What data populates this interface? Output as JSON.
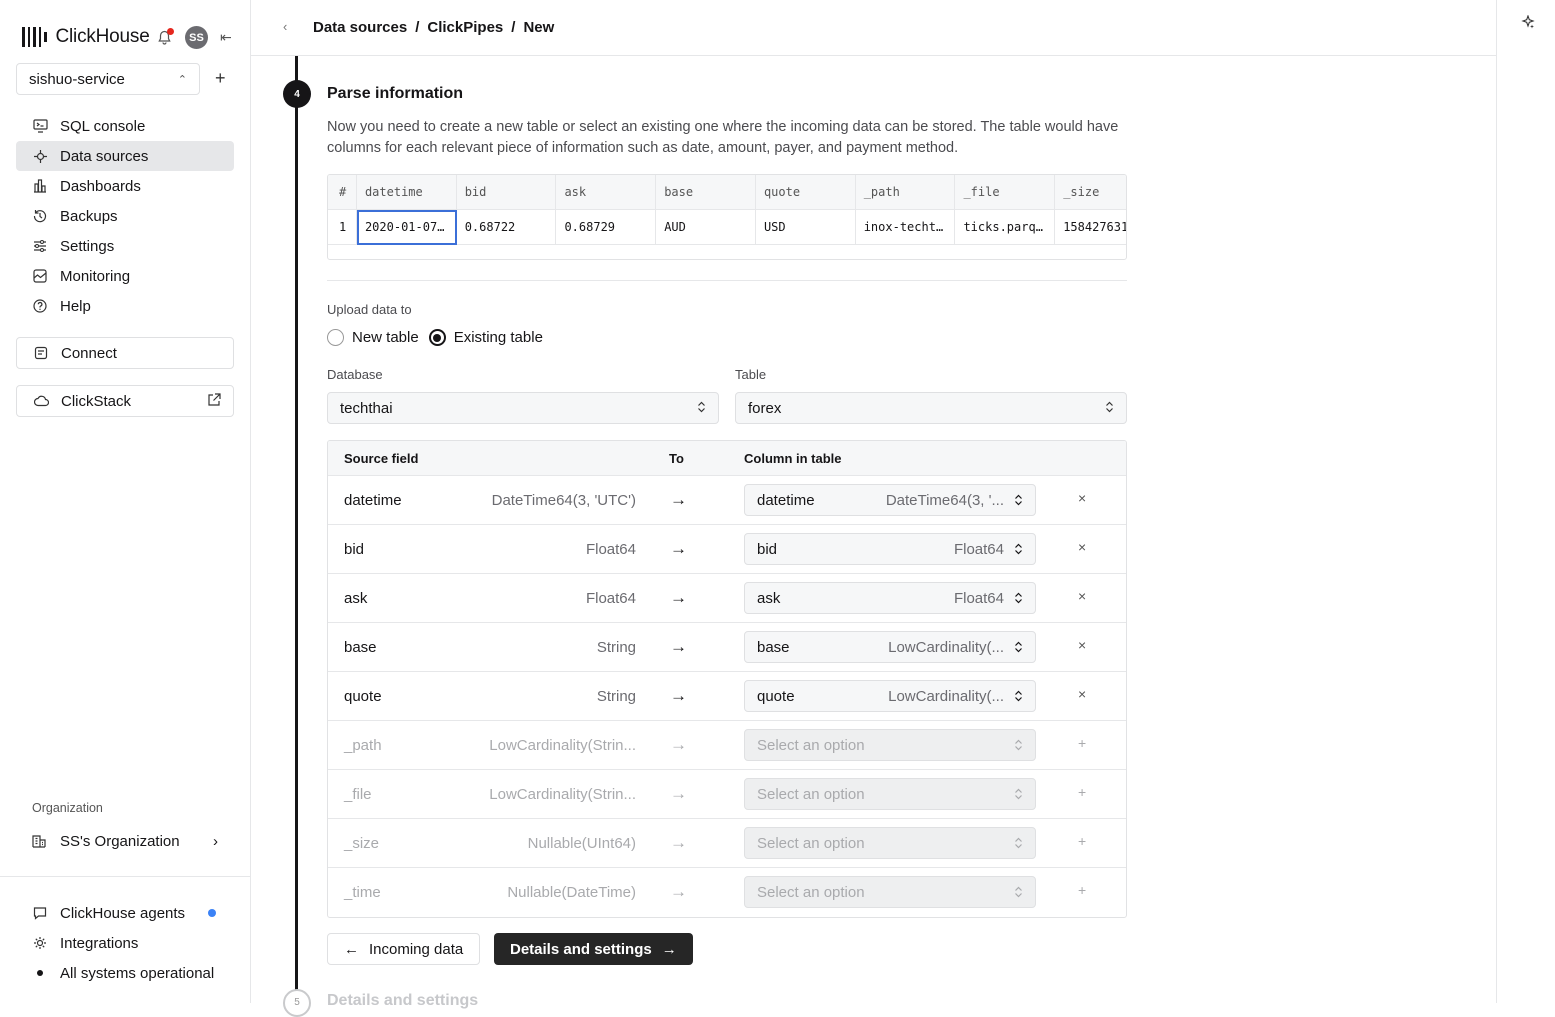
{
  "app": {
    "name": "ClickHouse",
    "avatar_initials": "SS",
    "service": "sishuo-service"
  },
  "nav": [
    {
      "label": "SQL console",
      "icon": "terminal-icon"
    },
    {
      "label": "Data sources",
      "icon": "data-sources-icon",
      "active": true
    },
    {
      "label": "Dashboards",
      "icon": "chart-icon"
    },
    {
      "label": "Backups",
      "icon": "history-icon"
    },
    {
      "label": "Settings",
      "icon": "sliders-icon"
    },
    {
      "label": "Monitoring",
      "icon": "monitor-icon"
    },
    {
      "label": "Help",
      "icon": "help-icon"
    }
  ],
  "connect_label": "Connect",
  "clickstack_label": "ClickStack",
  "organization": {
    "section_label": "Organization",
    "name": "SS's Organization"
  },
  "bottom_nav": {
    "agents": "ClickHouse agents",
    "integrations": "Integrations",
    "status": "All systems operational"
  },
  "breadcrumb": [
    "Data sources",
    "ClickPipes",
    "New"
  ],
  "breadcrumb_sep": "/",
  "step": {
    "number": "4",
    "title": "Parse information",
    "description": "Now you need to create a new table or select an existing one where the incoming data can be stored. The table would have columns for each relevant piece of information such as date, amount, payer, and payment method."
  },
  "preview": {
    "columns": [
      "#",
      "datetime",
      "bid",
      "ask",
      "base",
      "quote",
      "_path",
      "_file",
      "_size"
    ],
    "row": [
      "1",
      "2020-01-07…",
      "0.68722",
      "0.68729",
      "AUD",
      "USD",
      "inox-techt…",
      "ticks.parq…",
      "158427631"
    ]
  },
  "upload": {
    "label": "Upload data to",
    "new_table": "New table",
    "existing_table": "Existing table",
    "selected": "existing"
  },
  "database": {
    "label": "Database",
    "value": "techthai"
  },
  "table": {
    "label": "Table",
    "value": "forex"
  },
  "mapping": {
    "headers": {
      "source": "Source field",
      "to": "To",
      "column": "Column in table"
    },
    "placeholder": "Select an option",
    "rows": [
      {
        "field": "datetime",
        "type": "DateTime64(3, 'UTC')",
        "column": "datetime",
        "column_type": "DateTime64(3, '...",
        "action": "×"
      },
      {
        "field": "bid",
        "type": "Float64",
        "column": "bid",
        "column_type": "Float64",
        "action": "×"
      },
      {
        "field": "ask",
        "type": "Float64",
        "column": "ask",
        "column_type": "Float64",
        "action": "×"
      },
      {
        "field": "base",
        "type": "String",
        "column": "base",
        "column_type": "LowCardinality(...",
        "action": "×"
      },
      {
        "field": "quote",
        "type": "String",
        "column": "quote",
        "column_type": "LowCardinality(...",
        "action": "×"
      },
      {
        "field": "_path",
        "type": "LowCardinality(Strin...",
        "column": "",
        "column_type": "",
        "action": "+"
      },
      {
        "field": "_file",
        "type": "LowCardinality(Strin...",
        "column": "",
        "column_type": "",
        "action": "+"
      },
      {
        "field": "_size",
        "type": "Nullable(UInt64)",
        "column": "",
        "column_type": "",
        "action": "+"
      },
      {
        "field": "_time",
        "type": "Nullable(DateTime)",
        "column": "",
        "column_type": "",
        "action": "+"
      }
    ]
  },
  "buttons": {
    "back": "Incoming data",
    "next": "Details and settings"
  },
  "next_step": {
    "number": "5",
    "title": "Details and settings"
  },
  "colors": {
    "accent": "#161517",
    "notification": "#e5271e",
    "agents_dot": "#3b82f6"
  }
}
